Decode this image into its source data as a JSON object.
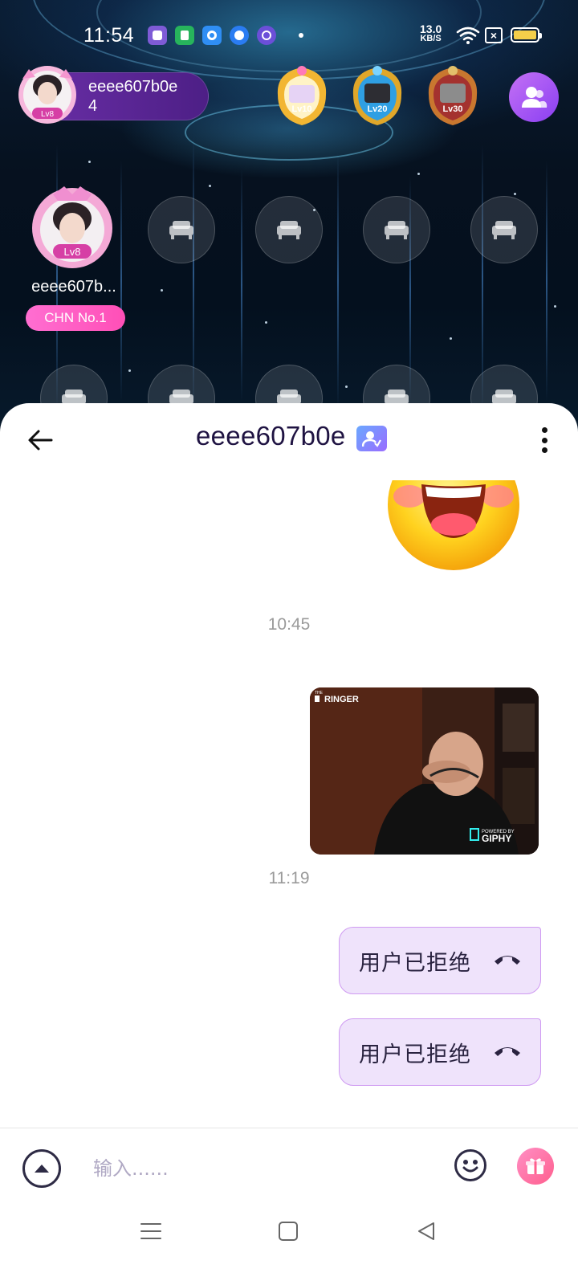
{
  "status_bar": {
    "time": "11:54",
    "net_speed_value": "13.0",
    "net_speed_unit": "KB/S",
    "battery_color": "#f5cf4a"
  },
  "room": {
    "host": {
      "name_line1": "eeee607b0e",
      "name_line2": "4",
      "level": "Lv8"
    },
    "badges": [
      {
        "label": "Lv10"
      },
      {
        "label": "Lv20"
      },
      {
        "label": "Lv30"
      }
    ],
    "occupant": {
      "name": "eeee607b...",
      "tag": "CHN No.1",
      "level": "Lv8"
    }
  },
  "chat": {
    "title": "eeee607b0e",
    "times": [
      "10:45",
      "11:19"
    ],
    "gif": {
      "brand": "RINGER",
      "powered_by": "POWERED BY",
      "giphy": "GIPHY",
      "the": "THE"
    },
    "call_messages": [
      {
        "text": "用户已拒绝"
      },
      {
        "text": "用户已拒绝"
      }
    ],
    "input_placeholder": "输入......"
  },
  "colors": {
    "accent_purple": "#8a3ff2",
    "bubble_bg": "#efe3fb",
    "bubble_border": "#cf9bf2",
    "tag_pink": "#ff4fb7"
  }
}
